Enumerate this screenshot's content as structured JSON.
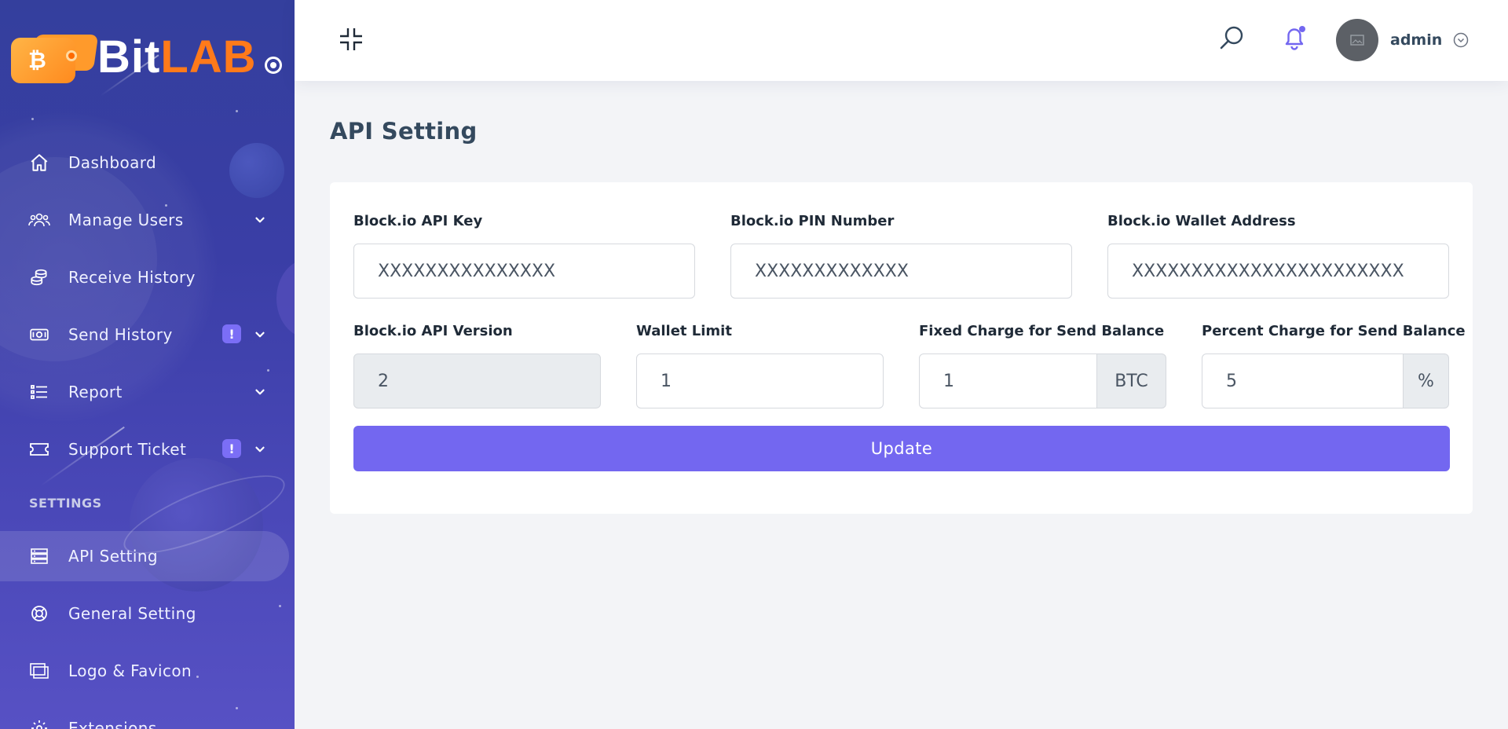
{
  "brand": {
    "name_part1": "Bit",
    "name_part2": "LAB",
    "coin_symbol": "₿",
    "accent_color": "#ff7a1a"
  },
  "sidebar": {
    "items": [
      {
        "label": "Dashboard",
        "icon": "home-icon"
      },
      {
        "label": "Manage Users",
        "icon": "users-icon",
        "has_submenu": true
      },
      {
        "label": "Receive History",
        "icon": "coins-icon"
      },
      {
        "label": "Send History",
        "icon": "money-icon",
        "has_submenu": true,
        "badge": "!"
      },
      {
        "label": "Report",
        "icon": "list-icon",
        "has_submenu": true
      },
      {
        "label": "Support Ticket",
        "icon": "ticket-icon",
        "has_submenu": true,
        "badge": "!"
      }
    ],
    "settings_heading": "SETTINGS",
    "settings_items": [
      {
        "label": "API Setting",
        "icon": "server-icon",
        "active": true
      },
      {
        "label": "General Setting",
        "icon": "lifering-icon"
      },
      {
        "label": "Logo & Favicon",
        "icon": "images-icon"
      },
      {
        "label": "Extensions",
        "icon": "cog-icon"
      }
    ]
  },
  "topbar": {
    "username": "admin",
    "notification_dot_color": "#7367f0"
  },
  "page": {
    "title": "API Setting"
  },
  "form": {
    "api_key": {
      "label": "Block.io API Key",
      "value": "XXXXXXXXXXXXXXX"
    },
    "pin": {
      "label": "Block.io PIN Number",
      "value": "XXXXXXXXXXXXX"
    },
    "wallet_address": {
      "label": "Block.io Wallet Address",
      "value": "XXXXXXXXXXXXXXXXXXXXXXX"
    },
    "api_version": {
      "label": "Block.io API Version",
      "value": "2"
    },
    "wallet_limit": {
      "label": "Wallet Limit",
      "value": "1"
    },
    "fixed_charge": {
      "label": "Fixed Charge for Send Balance",
      "value": "1",
      "unit": "BTC"
    },
    "percent_charge": {
      "label": "Percent Charge for Send Balance",
      "value": "5",
      "unit": "%"
    },
    "submit_label": "Update"
  },
  "colors": {
    "primary": "#7367f0",
    "sidebar_top": "#343f9d",
    "sidebar_bottom": "#5751c4"
  }
}
